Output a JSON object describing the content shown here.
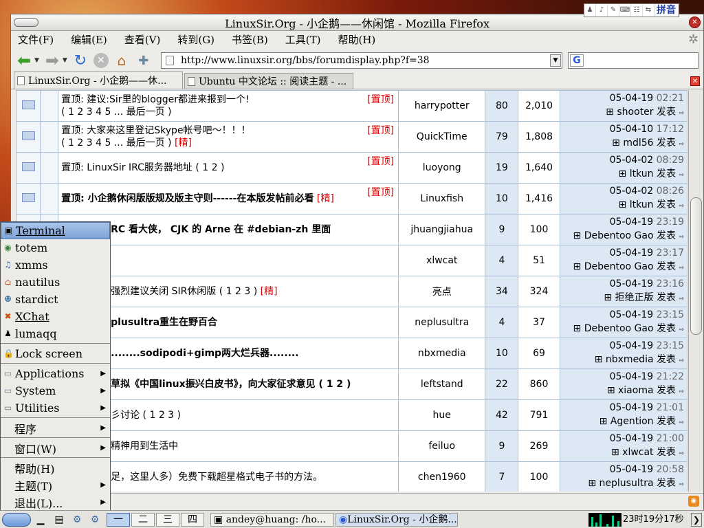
{
  "window": {
    "title": "LinuxSir.Org - 小企鹅——休闲馆 - Mozilla Firefox"
  },
  "ime": {
    "label": "拼音"
  },
  "menubar": [
    "文件(F)",
    "编辑(E)",
    "查看(V)",
    "转到(G)",
    "书签(B)",
    "工具(T)",
    "帮助(H)"
  ],
  "nav": {
    "url": "http://www.linuxsir.org/bbs/forumdisplay.php?f=38",
    "search_value": ""
  },
  "tabs": [
    "LinuxSir.Org - 小企鹅——休...",
    "Ubuntu 中文论坛 :: 阅读主题 - ..."
  ],
  "threads": [
    {
      "pre": "置顶: 建议:Sir里的blogger都进来报到一个!",
      "pages": "( 1 2 3 4 5 ... 最后一页 )",
      "tag": "[置顶]",
      "author": "harrypotter",
      "replies": "80",
      "views": "2,010",
      "date": "05-04-19",
      "time": "02:21",
      "by": "shooter",
      "post": "发表"
    },
    {
      "pre": "置顶: 大家来这里登记Skype帐号吧～！！！",
      "pages": "( 1 2 3 4 5 ... 最后一页 )",
      "flag": "[精]",
      "tag": "[置顶]",
      "author": "QuickTime",
      "replies": "79",
      "views": "1,808",
      "date": "05-04-10",
      "time": "17:12",
      "by": "mdl56",
      "post": "发表"
    },
    {
      "pre": "置顶: LinuxSir IRC服务器地址 ( 1 2 )",
      "tag": "[置顶]",
      "author": "luoyong",
      "replies": "19",
      "views": "1,640",
      "date": "05-04-02",
      "time": "08:29",
      "by": "ltkun",
      "post": "发表"
    },
    {
      "pre": "置顶: 小企鹅休闲版版规及版主守则------在本版发帖前必看",
      "flag": "[精]",
      "tag": "[置顶]",
      "author": "Linuxfish",
      "replies": "10",
      "views": "1,416",
      "date": "05-04-02",
      "time": "08:26",
      "by": "ltkun",
      "post": "发表"
    },
    {
      "pre": "RC 看大侠， CJK 的 Arne 在 #debian-zh 里面",
      "author": "jhuangjiahua",
      "replies": "9",
      "views": "100",
      "date": "05-04-19",
      "time": "23:19",
      "by": "Debentoo Gao",
      "post": "发表"
    },
    {
      "pre": "",
      "author": "xlwcat",
      "replies": "4",
      "views": "51",
      "date": "05-04-19",
      "time": "23:17",
      "by": "Debentoo Gao",
      "post": "发表"
    },
    {
      "pre": "强烈建议关闭 SIR休闲版 ( 1 2 3 )",
      "flag": "[精]",
      "author": "亮点",
      "replies": "34",
      "views": "324",
      "date": "05-04-19",
      "time": "23:16",
      "by": "拒绝正版",
      "post": "发表"
    },
    {
      "pre": "plusultra重生在野百合",
      "author": "neplusultra",
      "replies": "4",
      "views": "37",
      "date": "05-04-19",
      "time": "23:15",
      "by": "Debentoo Gao",
      "post": "发表"
    },
    {
      "pre": "........sodipodi+gimp两大烂兵器........",
      "author": "nbxmedia",
      "replies": "10",
      "views": "69",
      "date": "05-04-19",
      "time": "23:15",
      "by": "nbxmedia",
      "post": "发表"
    },
    {
      "pre": "草拟《中国linux振兴白皮书》，向大家征求意见 ( 1 2 )",
      "author": "leftstand",
      "replies": "22",
      "views": "860",
      "date": "05-04-19",
      "time": "21:22",
      "by": "xiaoma",
      "post": "发表"
    },
    {
      "pre": "彡讨论 ( 1 2 3 )",
      "author": "hue",
      "replies": "42",
      "views": "791",
      "date": "05-04-19",
      "time": "21:01",
      "by": "Agention",
      "post": "发表"
    },
    {
      "pre": "精神用到生活中",
      "author": "feiluo",
      "replies": "9",
      "views": "269",
      "date": "05-04-19",
      "time": "21:00",
      "by": "xlwcat",
      "post": "发表"
    },
    {
      "pre": "足，这里人多）免费下载超星格式电子书的方法。",
      "author": "chen1960",
      "replies": "7",
      "views": "100",
      "date": "05-04-19",
      "time": "20:58",
      "by": "neplusultra",
      "post": "发表"
    }
  ],
  "menu": {
    "apps": [
      "Terminal",
      "totem",
      "xmms",
      "nautilus",
      "stardict",
      "XChat",
      "lumaqq"
    ],
    "lock": "Lock screen",
    "groups": [
      "Applications",
      "System",
      "Utilities"
    ],
    "cn": [
      "程序",
      "窗口(W)",
      "帮助(H)",
      "主题(T)",
      "退出(L)..."
    ]
  },
  "taskbar": {
    "desktops": [
      "一",
      "二",
      "三",
      "四"
    ],
    "tasks": [
      "andey@huang: /ho...",
      "LinuxSir.Org - 小企鹅..."
    ],
    "clock": "23时19分17秒"
  }
}
